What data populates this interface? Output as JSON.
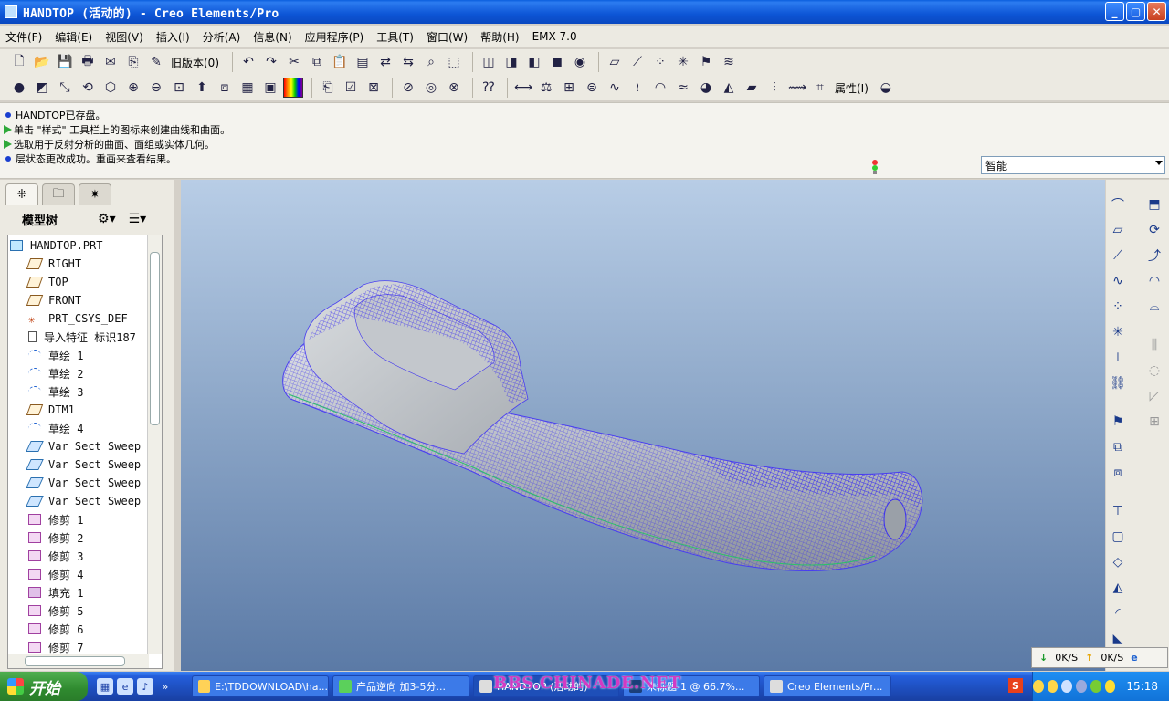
{
  "window": {
    "title": "HANDTOP (活动的) - Creo Elements/Pro"
  },
  "menu": [
    "文件(F)",
    "编辑(E)",
    "视图(V)",
    "插入(I)",
    "分析(A)",
    "信息(N)",
    "应用程序(P)",
    "工具(T)",
    "窗口(W)",
    "帮助(H)",
    "EMX 7.0"
  ],
  "toolbar": {
    "old_version_label": "旧版本(0)",
    "properties_label": "属性(I)"
  },
  "messages": [
    {
      "kind": "info",
      "text": "HANDTOP已存盘。"
    },
    {
      "kind": "prompt",
      "text": "单击 \"样式\" 工具栏上的图标来创建曲线和曲面。"
    },
    {
      "kind": "prompt",
      "text": "选取用于反射分析的曲面、面组或实体几何。"
    },
    {
      "kind": "info",
      "text": "层状态更改成功。重画来查看结果。"
    }
  ],
  "filter": {
    "value": "智能"
  },
  "model_tree": {
    "title": "模型树",
    "root": "HANDTOP.PRT",
    "items": [
      {
        "label": "RIGHT",
        "icon": "datum-plane-icon"
      },
      {
        "label": "TOP",
        "icon": "datum-plane-icon"
      },
      {
        "label": "FRONT",
        "icon": "datum-plane-icon"
      },
      {
        "label": "PRT_CSYS_DEF",
        "icon": "csys-icon"
      },
      {
        "label": "导入特征 标识187",
        "icon": "import-feature-icon"
      },
      {
        "label": "草绘 1",
        "icon": "sketch-icon"
      },
      {
        "label": "草绘 2",
        "icon": "sketch-icon"
      },
      {
        "label": "草绘 3",
        "icon": "sketch-icon"
      },
      {
        "label": "DTM1",
        "icon": "datum-plane-icon"
      },
      {
        "label": "草绘 4",
        "icon": "sketch-icon"
      },
      {
        "label": "Var Sect Sweep",
        "icon": "sweep-icon"
      },
      {
        "label": "Var Sect Sweep",
        "icon": "sweep-icon"
      },
      {
        "label": "Var Sect Sweep",
        "icon": "sweep-icon"
      },
      {
        "label": "Var Sect Sweep",
        "icon": "sweep-icon"
      },
      {
        "label": "修剪 1",
        "icon": "trim-icon"
      },
      {
        "label": "修剪 2",
        "icon": "trim-icon"
      },
      {
        "label": "修剪 3",
        "icon": "trim-icon"
      },
      {
        "label": "修剪 4",
        "icon": "trim-icon"
      },
      {
        "label": "填充 1",
        "icon": "fill-icon"
      },
      {
        "label": "修剪 5",
        "icon": "trim-icon"
      },
      {
        "label": "修剪 6",
        "icon": "trim-icon"
      },
      {
        "label": "修剪 7",
        "icon": "trim-icon"
      }
    ]
  },
  "net": {
    "down": "0K/S",
    "up": "0K/S"
  },
  "taskbar": {
    "start": "开始",
    "tasks": [
      "E:\\TDDOWNLOAD\\ha...",
      "产品逆向 加3-5分...",
      "HANDTOP (活动的)",
      "未标题-1 @ 66.7%...",
      "Creo Elements/Pr..."
    ],
    "clock": "15:18"
  },
  "watermark": "BBS.CHINADE.NET",
  "colors": {
    "mesh": "#3b2ff0",
    "surface": "#c8ccd0",
    "viewport_top": "#b8cde6",
    "viewport_bottom": "#5b7aa6"
  }
}
